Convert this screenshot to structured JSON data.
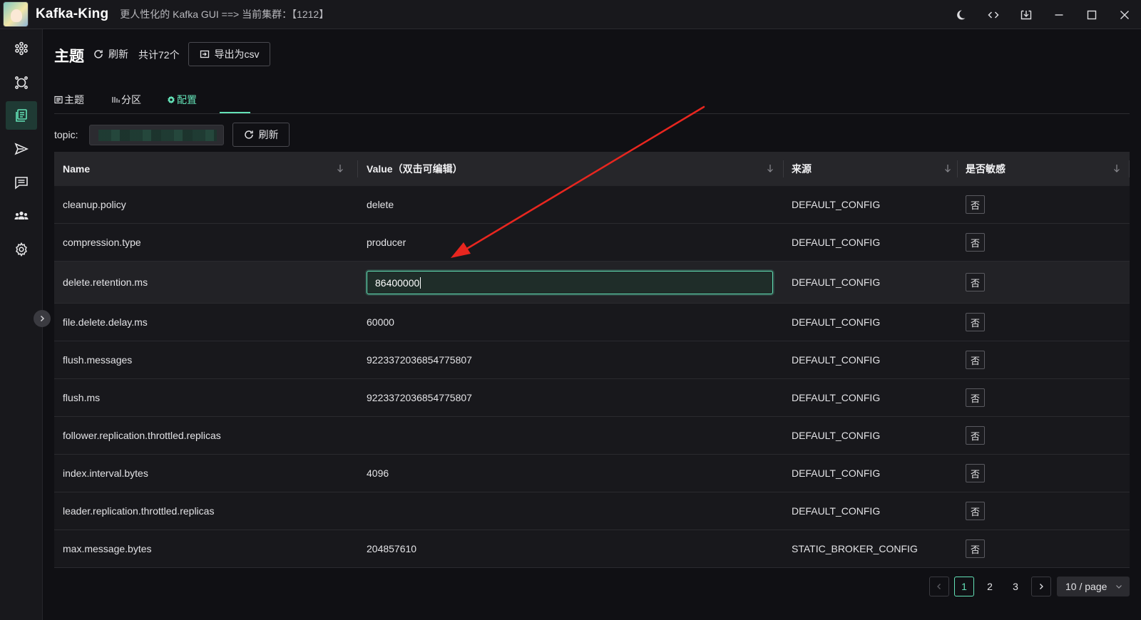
{
  "window": {
    "app_title": "Kafka-King",
    "subtitle": "更人性化的 Kafka GUI ==> 当前集群：【1212】",
    "controls": [
      {
        "name": "theme-toggle-button",
        "icon": "moon-icon"
      },
      {
        "name": "devtools-button",
        "icon": "code-icon"
      },
      {
        "name": "download-button",
        "icon": "download-icon"
      },
      {
        "name": "minimize-button",
        "icon": "minimize-icon"
      },
      {
        "name": "maximize-button",
        "icon": "maximize-icon"
      },
      {
        "name": "close-button",
        "icon": "close-icon"
      }
    ]
  },
  "sidebar": {
    "items": [
      {
        "name": "sidebar-item-cluster",
        "icon": "cluster-icon",
        "active": false
      },
      {
        "name": "sidebar-item-nodes",
        "icon": "node-icon",
        "active": false
      },
      {
        "name": "sidebar-item-topics",
        "icon": "topic-list-icon",
        "active": true
      },
      {
        "name": "sidebar-item-producer",
        "icon": "send-icon",
        "active": false
      },
      {
        "name": "sidebar-item-consumer",
        "icon": "message-icon",
        "active": false
      },
      {
        "name": "sidebar-item-groups",
        "icon": "group-icon",
        "active": false
      },
      {
        "name": "sidebar-item-settings",
        "icon": "gear-icon",
        "active": false
      }
    ]
  },
  "header": {
    "title": "主题",
    "refresh_label": "刷新",
    "total_label": "共计72个",
    "export_label": "导出为csv"
  },
  "tabs": [
    {
      "label": "主题",
      "active": false
    },
    {
      "label": "分区",
      "active": false
    },
    {
      "label": "配置",
      "active": true
    }
  ],
  "topic_filter": {
    "label": "topic:",
    "refresh_label": "刷新"
  },
  "table": {
    "columns": [
      "Name",
      "Value（双击可编辑）",
      "来源",
      "是否敏感"
    ],
    "rows": [
      {
        "name": "cleanup.policy",
        "value": "delete",
        "source": "DEFAULT_CONFIG",
        "sensitive": "否"
      },
      {
        "name": "compression.type",
        "value": "producer",
        "source": "DEFAULT_CONFIG",
        "sensitive": "否"
      },
      {
        "name": "delete.retention.ms",
        "value": "86400000",
        "source": "DEFAULT_CONFIG",
        "sensitive": "否",
        "editing": true
      },
      {
        "name": "file.delete.delay.ms",
        "value": "60000",
        "source": "DEFAULT_CONFIG",
        "sensitive": "否"
      },
      {
        "name": "flush.messages",
        "value": "9223372036854775807",
        "source": "DEFAULT_CONFIG",
        "sensitive": "否"
      },
      {
        "name": "flush.ms",
        "value": "9223372036854775807",
        "source": "DEFAULT_CONFIG",
        "sensitive": "否"
      },
      {
        "name": "follower.replication.throttled.replicas",
        "value": "",
        "source": "DEFAULT_CONFIG",
        "sensitive": "否"
      },
      {
        "name": "index.interval.bytes",
        "value": "4096",
        "source": "DEFAULT_CONFIG",
        "sensitive": "否"
      },
      {
        "name": "leader.replication.throttled.replicas",
        "value": "",
        "source": "DEFAULT_CONFIG",
        "sensitive": "否"
      },
      {
        "name": "max.message.bytes",
        "value": "204857610",
        "source": "STATIC_BROKER_CONFIG",
        "sensitive": "否"
      }
    ]
  },
  "pagination": {
    "pages": [
      "1",
      "2",
      "3"
    ],
    "current_page": "1",
    "page_size_label": "10 / page"
  },
  "colors": {
    "accent": "#63e2b7",
    "annotation_arrow": "#e8261f",
    "background": "#101014"
  }
}
